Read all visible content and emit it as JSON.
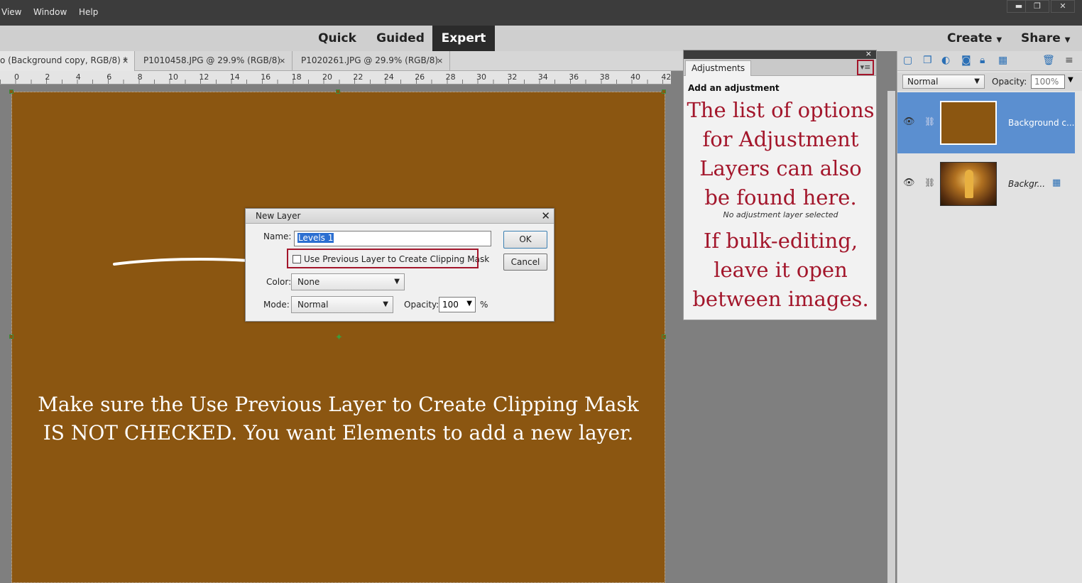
{
  "menubar": {
    "items": [
      "View",
      "Window",
      "Help"
    ]
  },
  "window_controls": {
    "minimize": "▬",
    "restore": "❐",
    "close": "✕"
  },
  "modes": {
    "quick": "Quick",
    "guided": "Guided",
    "expert": "Expert"
  },
  "actions": {
    "create": "Create",
    "share": "Share"
  },
  "tabs": [
    {
      "label": "o (Background copy, RGB/8) *",
      "close": "×"
    },
    {
      "label": "P1010458.JPG @ 29.9% (RGB/8)",
      "close": "×"
    },
    {
      "label": "P1020261.JPG @ 29.9% (RGB/8)",
      "close": "×"
    }
  ],
  "ruler": {
    "ticks": [
      "0",
      "2",
      "4",
      "6",
      "8",
      "10",
      "12",
      "14",
      "16",
      "18",
      "20",
      "22",
      "24",
      "26",
      "28",
      "30",
      "32",
      "34",
      "36",
      "38",
      "40",
      "42"
    ]
  },
  "canvas": {
    "color": "#8b5611"
  },
  "dialog": {
    "title": "New Layer",
    "close": "✕",
    "name_label": "Name:",
    "name_value": "Levels 1",
    "checkbox_label": "Use Previous Layer to Create Clipping Mask",
    "color_label": "Color:",
    "color_value": "None",
    "mode_label": "Mode:",
    "mode_value": "Normal",
    "opacity_label": "Opacity:",
    "opacity_value": "100",
    "percent": "%",
    "ok": "OK",
    "cancel": "Cancel"
  },
  "canvas_note": {
    "line1": "Make sure the Use Previous Layer to Create Clipping Mask",
    "line2": "IS NOT CHECKED. You want Elements to add a new layer."
  },
  "adjustments": {
    "tab": "Adjustments",
    "close": "×",
    "menu_icon": "▾≡",
    "heading": "Add an adjustment",
    "note_top": [
      "The list of options",
      "for Adjustment",
      "Layers can also",
      "be found here."
    ],
    "no_selection": "No adjustment layer selected",
    "note_bottom": [
      "If bulk-editing,",
      "leave it open",
      "between images."
    ]
  },
  "layers": {
    "blend_mode": "Normal",
    "opacity_label": "Opacity:",
    "opacity_value": "100%",
    "items": [
      {
        "name": "Background c...",
        "selected": true
      },
      {
        "name": "Backgr...",
        "selected": false
      }
    ]
  },
  "colors": {
    "annotation": "#a3162b",
    "selection": "#5b8fd0",
    "active_mode": "#2b2b2b"
  }
}
